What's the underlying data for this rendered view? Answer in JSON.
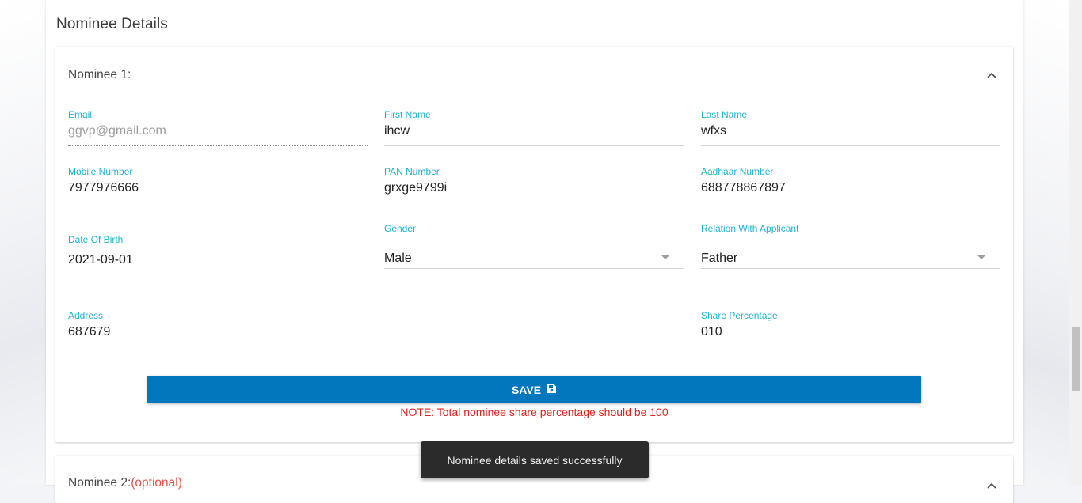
{
  "section": {
    "title": "Nominee Details"
  },
  "nominee1": {
    "title": "Nominee 1:",
    "fields": {
      "email": {
        "label": "Email",
        "value": "ggvp@gmail.com"
      },
      "first_name": {
        "label": "First Name",
        "value": "ihcw"
      },
      "last_name": {
        "label": "Last Name",
        "value": "wfxs"
      },
      "mobile": {
        "label": "Mobile Number",
        "value": "7977976666"
      },
      "pan": {
        "label": "PAN Number",
        "value": "grxge9799i"
      },
      "aadhaar": {
        "label": "Aadhaar Number",
        "value": "688778867897"
      },
      "dob": {
        "label": "Date Of Birth",
        "value": "2021-09-01"
      },
      "gender": {
        "label": "Gender",
        "value": "Male"
      },
      "relation": {
        "label": "Relation With Applicant",
        "value": "Father"
      },
      "address": {
        "label": "Address",
        "value": "687679"
      },
      "share": {
        "label": "Share Percentage",
        "value": "010"
      }
    },
    "save_label": "SAVE",
    "note": "NOTE: Total nominee share percentage should be 100"
  },
  "nominee2": {
    "title": "Nominee 2:",
    "optional": "(optional)"
  },
  "toast": {
    "message": "Nominee details saved successfully"
  },
  "icons": {
    "collapse": "chevron-up-icon",
    "save": "floppy-disk-icon",
    "dropdown": "caret-down-icon"
  },
  "colors": {
    "accent": "#1fb3cf",
    "button": "#0277bd",
    "note": "#e0211f",
    "toast_bg": "#2b2b2b"
  }
}
